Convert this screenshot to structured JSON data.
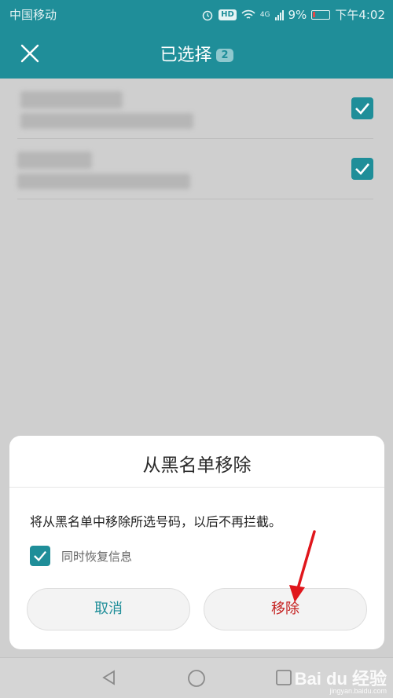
{
  "status_bar": {
    "carrier": "中国移动",
    "hd_badge": "HD",
    "network": "4G",
    "battery": "9%",
    "time": "下午4:02"
  },
  "header": {
    "title": "已选择",
    "count": "2",
    "icons": {
      "close": "close-icon"
    }
  },
  "list": {
    "items": [
      {
        "checked": true
      },
      {
        "checked": true
      }
    ]
  },
  "dialog": {
    "title": "从黑名单移除",
    "message": "将从黑名单中移除所选号码，以后不再拦截。",
    "option_label": "同时恢复信息",
    "option_checked": true,
    "cancel_label": "取消",
    "remove_label": "移除"
  },
  "watermark": {
    "brand": "Bai du 经验",
    "sub": "jingyan.baidu.com"
  },
  "colors": {
    "accent": "#1f8e99",
    "danger": "#c4201f",
    "arrow": "#e0161c"
  }
}
